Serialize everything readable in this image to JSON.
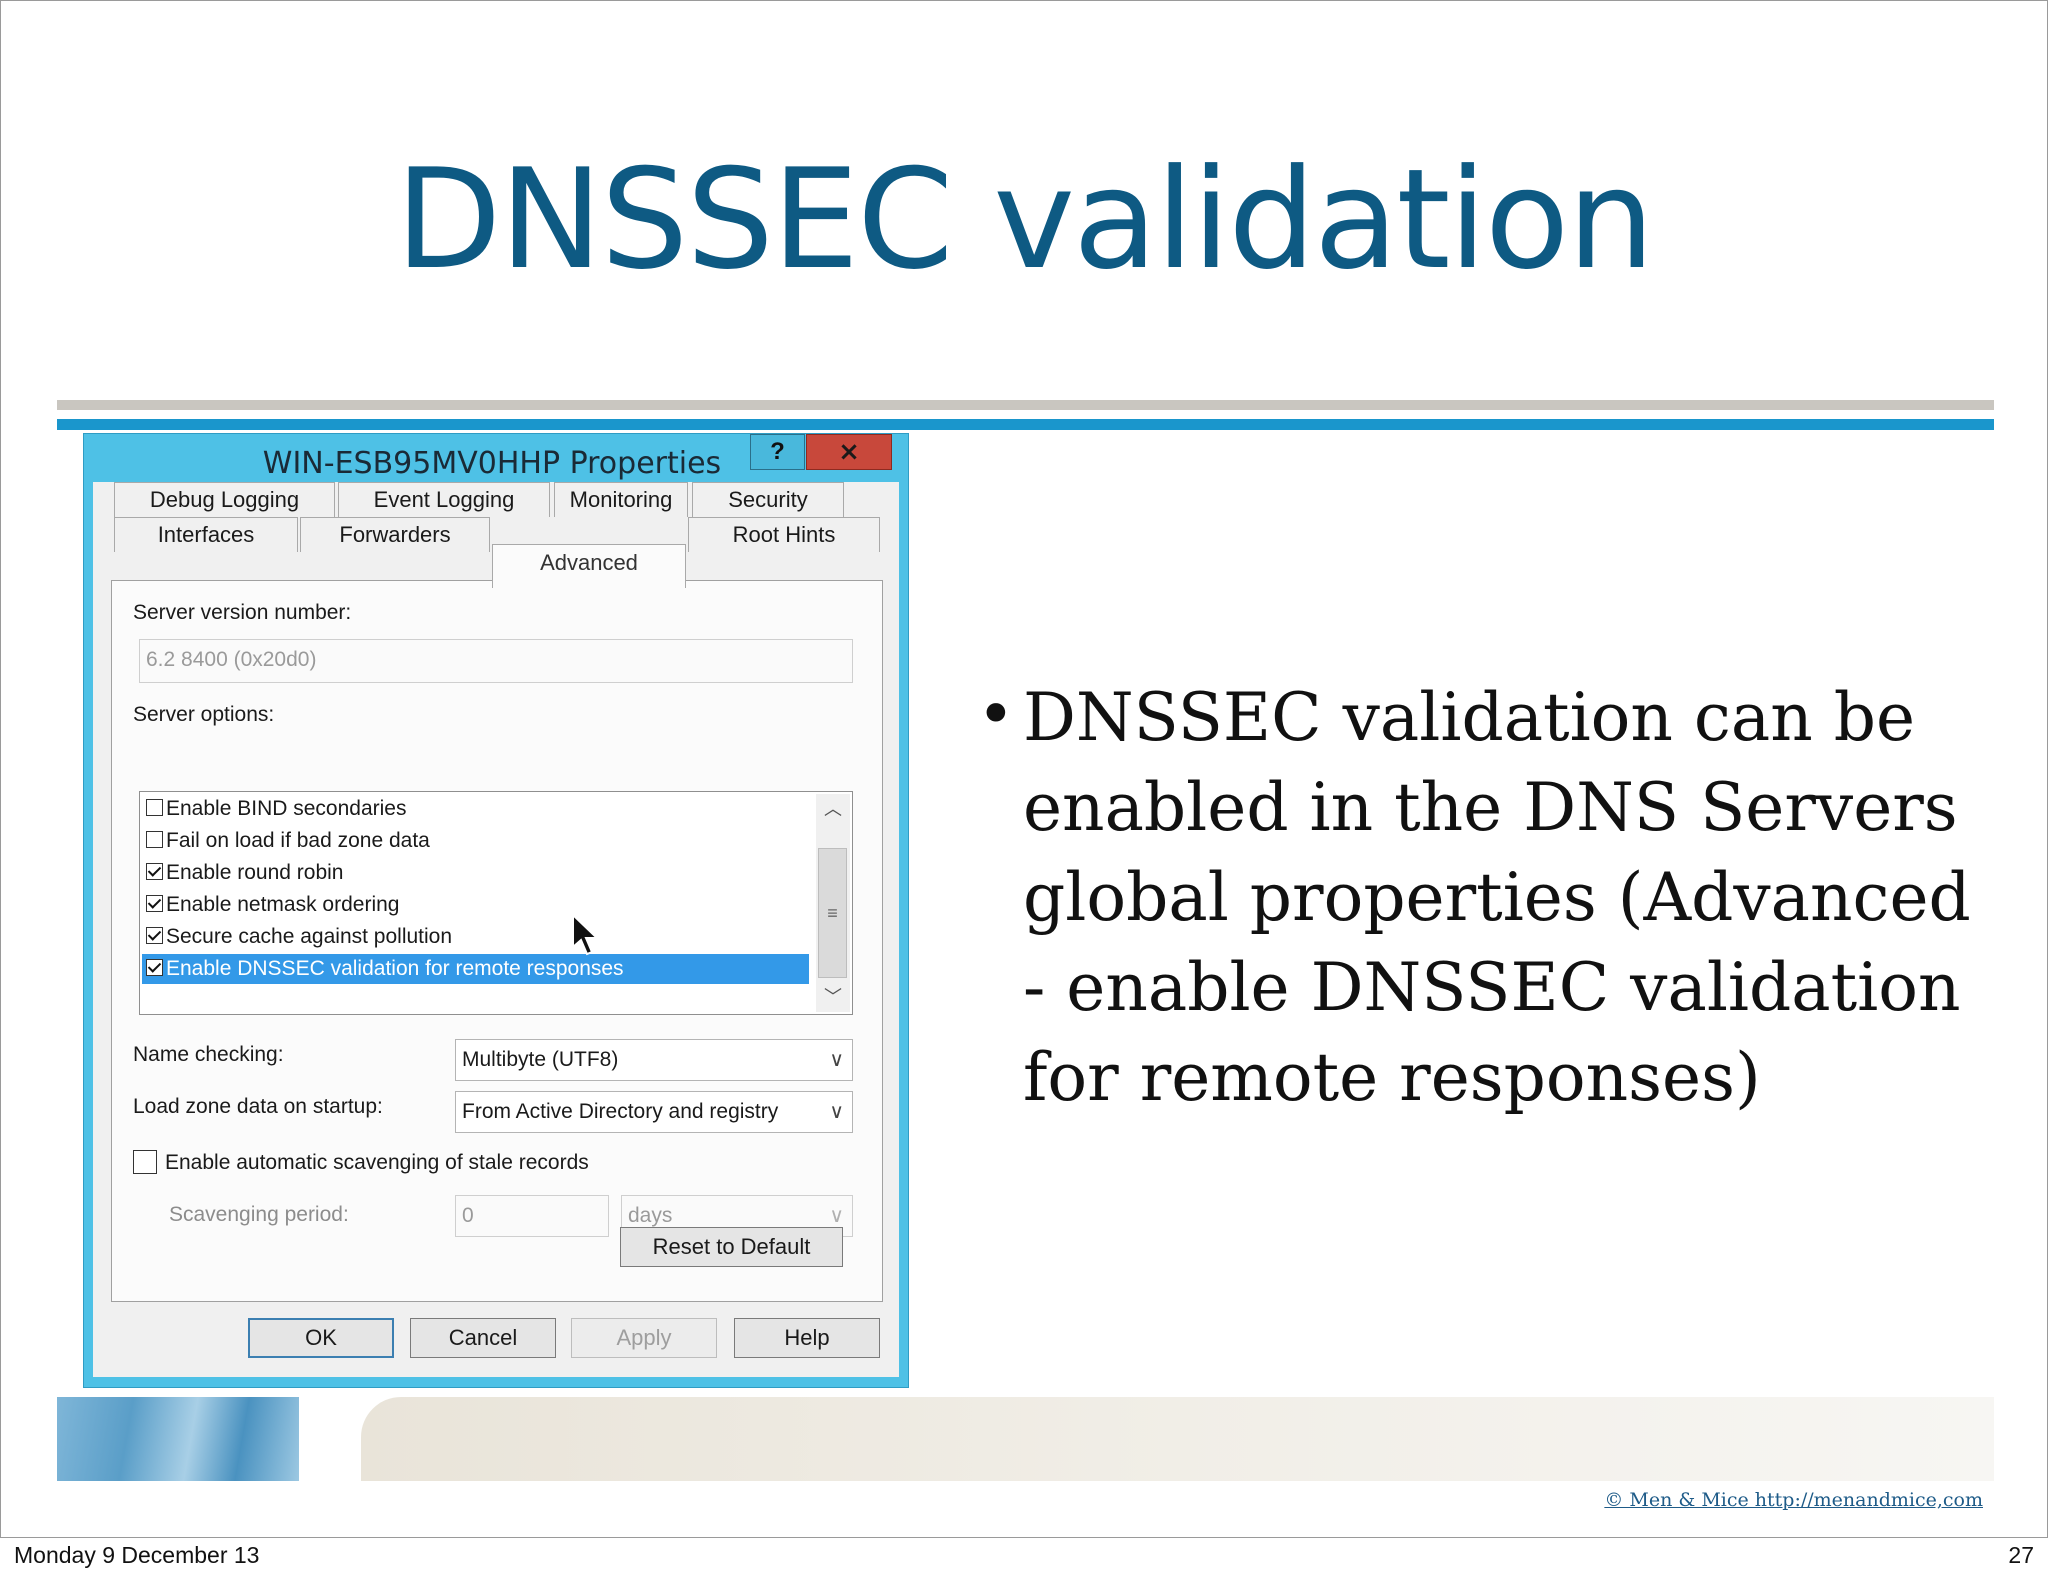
{
  "slide": {
    "title": "DNSSEC validation",
    "bullet": "DNSSEC validation can be enabled in the DNS Servers global properties (Advanced - enable DNSSEC validation for remote responses)",
    "copyright": "© Men & Mice  http://menandmice,com",
    "footer_date": "Monday 9 December 13",
    "page_number": "27"
  },
  "dialog": {
    "title": "WIN-ESB95MV0HHP Properties",
    "help_label": "?",
    "close_label": "×",
    "tabs_row1": [
      "Debug Logging",
      "Event Logging",
      "Monitoring",
      "Security"
    ],
    "tabs_row2": [
      "Interfaces",
      "Forwarders",
      "Advanced",
      "Root Hints"
    ],
    "active_tab": "Advanced",
    "server_version_label": "Server version number:",
    "server_version_value": "6.2 8400 (0x20d0)",
    "server_options_label": "Server options:",
    "server_options": [
      {
        "label": "Enable BIND secondaries",
        "checked": false,
        "selected": false
      },
      {
        "label": "Fail on load if bad zone data",
        "checked": false,
        "selected": false
      },
      {
        "label": "Enable round robin",
        "checked": true,
        "selected": false
      },
      {
        "label": "Enable netmask ordering",
        "checked": true,
        "selected": false
      },
      {
        "label": "Secure cache against pollution",
        "checked": true,
        "selected": false
      },
      {
        "label": "Enable DNSSEC validation for remote responses",
        "checked": true,
        "selected": true
      }
    ],
    "name_checking_label": "Name checking:",
    "name_checking_value": "Multibyte (UTF8)",
    "load_zone_label": "Load zone data on startup:",
    "load_zone_value": "From Active Directory and registry",
    "scavenging_label": "Enable automatic scavenging of stale records",
    "scavenging_checked": false,
    "scavenging_period_label": "Scavenging period:",
    "scavenging_period_value": "0",
    "scavenging_unit": "days",
    "reset_label": "Reset to Default",
    "ok_label": "OK",
    "cancel_label": "Cancel",
    "apply_label": "Apply",
    "help_button_label": "Help"
  }
}
